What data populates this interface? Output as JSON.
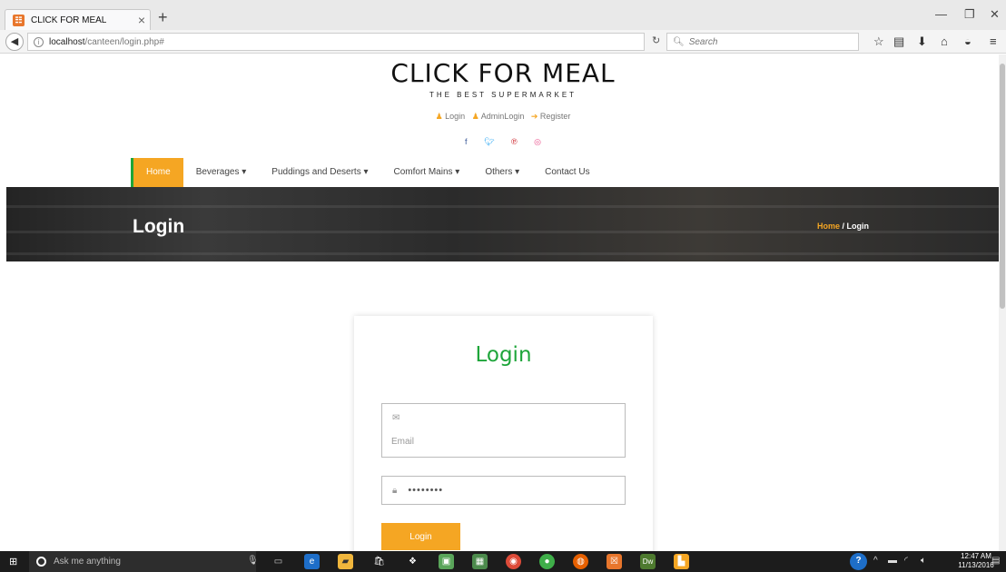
{
  "browser": {
    "tab_title": "CLICK FOR MEAL",
    "favicon_glyph": "☷",
    "url_host": "localhost",
    "url_path": "/canteen/login.php#",
    "search_placeholder": "Search"
  },
  "site": {
    "brand": "CLICK FOR MEAL",
    "tagline": "THE BEST SUPERMARKET",
    "auth_links": {
      "login": "Login",
      "admin_login": "AdminLogin",
      "register": "Register"
    },
    "social_icons": [
      "facebook-icon",
      "twitter-icon",
      "pinterest-icon",
      "dribbble-icon"
    ],
    "menu": [
      {
        "label": "Home",
        "active": true
      },
      {
        "label": "Beverages ▾"
      },
      {
        "label": "Puddings and Deserts ▾"
      },
      {
        "label": "Comfort Mains ▾"
      },
      {
        "label": "Others ▾"
      },
      {
        "label": "Contact Us"
      }
    ],
    "banner": {
      "title": "Login",
      "crumb_home": "Home",
      "crumb_sep": " / ",
      "crumb_current": "Login"
    },
    "login_card": {
      "title": "Login",
      "email_placeholder": "Email",
      "password_value": "••••••••",
      "button_label": "Login"
    }
  },
  "taskbar": {
    "cortana_placeholder": "Ask me anything",
    "time": "12:47 AM",
    "date": "11/13/2016"
  },
  "colors": {
    "accent_orange": "#f5a623",
    "accent_green": "#1ea53a"
  }
}
